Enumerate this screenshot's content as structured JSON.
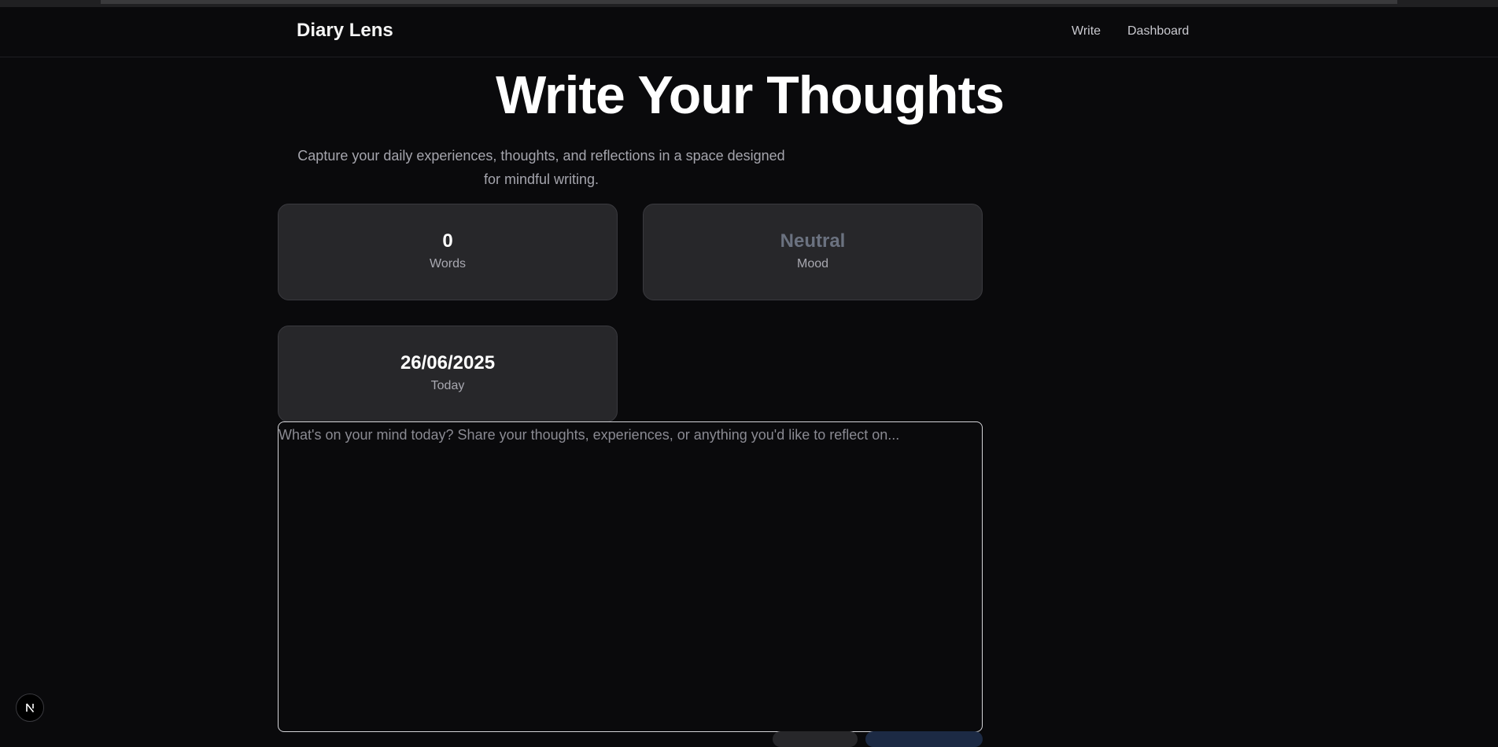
{
  "app": {
    "brand": "Diary Lens"
  },
  "nav": {
    "write": "Write",
    "dashboard": "Dashboard"
  },
  "hero": {
    "title": "Write Your Thoughts",
    "subtitle_line1": "Capture your daily experiences, thoughts, and reflections in a space designed",
    "subtitle_line2": "for mindful writing."
  },
  "stats": {
    "words": {
      "value": "0",
      "label": "Words"
    },
    "mood": {
      "value": "Neutral",
      "label": "Mood",
      "color": "#6b7280"
    },
    "date": {
      "value": "26/06/2025",
      "label": "Today"
    }
  },
  "editor": {
    "value": "",
    "placeholder": "What's on your mind today? Share your thoughts, experiences, or anything you'd like to reflect on..."
  },
  "dev_badge": {
    "icon": "nextjs-logo-icon"
  },
  "theme": {
    "background": "#0a0a0c",
    "card": "#27272a",
    "accent_dark_blue": "#1c2a44"
  }
}
